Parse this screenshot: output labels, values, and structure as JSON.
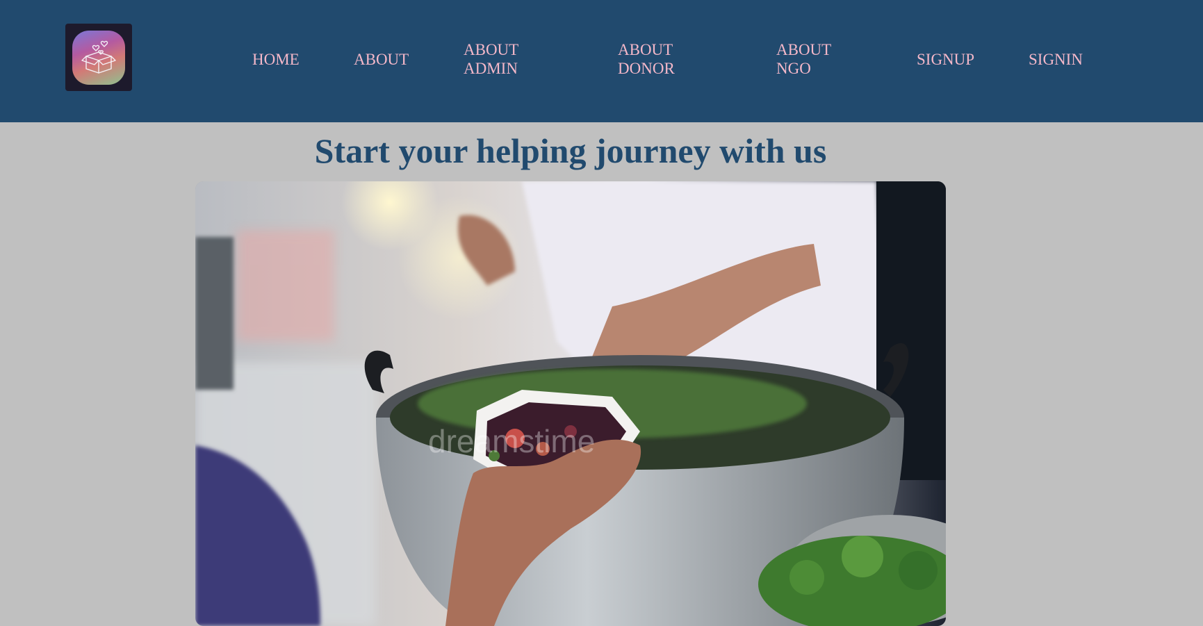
{
  "logo": {
    "icon": "donation-box-hearts-icon"
  },
  "nav": {
    "home": "HOME",
    "about": "ABOUT",
    "about_admin_line1": "ABOUT",
    "about_admin_line2": "ADMIN",
    "about_donor_line1": "ABOUT",
    "about_donor_line2": "DONOR",
    "about_ngo_line1": "ABOUT",
    "about_ngo_line2": "NGO",
    "signup": "SIGNUP",
    "signin": "SIGNIN"
  },
  "hero": {
    "heading": "Start your helping journey with us",
    "image_watermark": "dreamstime"
  },
  "colors": {
    "navbar_bg": "#214a6e",
    "nav_link": "#f4b8c9",
    "page_bg": "#c0c0c0",
    "heading": "#214a6e"
  }
}
